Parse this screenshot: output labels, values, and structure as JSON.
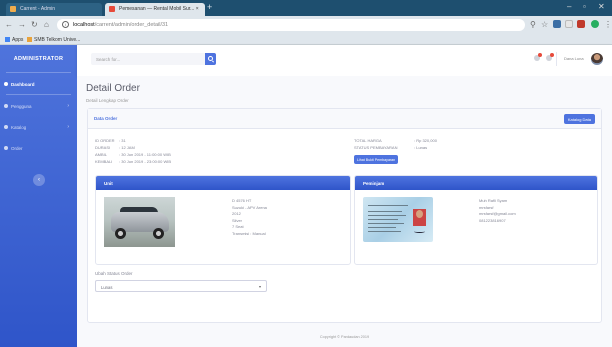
{
  "browser": {
    "tabs": [
      {
        "label": "Carrent - Admin"
      },
      {
        "label": "Pemesanan — Rental Mobil Sur... ×"
      }
    ],
    "url_host": "localhost",
    "url_path": "/carrent/admin/order_detail/31",
    "bookmarks": [
      {
        "label": "Apps"
      },
      {
        "label": "SMB Telkom Unive..."
      }
    ]
  },
  "sidebar": {
    "brand": "ADMINISTRATOR",
    "items": [
      {
        "label": "Dashboard",
        "active": true
      },
      {
        "label": "Pengguna",
        "chevron": "›"
      },
      {
        "label": "Katalog",
        "chevron": "›"
      },
      {
        "label": "Order"
      }
    ],
    "toggle": "‹"
  },
  "topbar": {
    "search_placeholder": "Search for...",
    "username": "Dana Luna"
  },
  "page": {
    "title": "Detail Order",
    "subtitle": "Detail Lengkap Order"
  },
  "card": {
    "title": "Data Order",
    "back_button": "Katalog Data"
  },
  "order": {
    "id_label": "ID ORDER",
    "id_value": "31",
    "durasi_label": "DURASI",
    "durasi_value": "12 JAM",
    "ambil_label": "AMBIL",
    "ambil_value": "30 Jun 2019 - 11:00:00 WIB",
    "kembali_label": "KEMBALI",
    "kembali_value": "30 Jun 2019 - 23:00:00 WIB",
    "total_label": "TOTAL HARGA",
    "total_value": "Rp 320,000",
    "status_label": "STATUS PEMBAYARAN",
    "status_value": "Lunas",
    "proof_button": "Lihat Bukti Pembayaran"
  },
  "unit": {
    "header": "Unit",
    "lines": [
      "D 4576 HT",
      "Suzuki - APV Arena",
      "2012",
      "Silver",
      "7 Seat",
      "Transmisi : Manual"
    ]
  },
  "peminjam": {
    "header": "Peminjam",
    "lines": [
      "Muh Rafli Syam",
      "mrsfarsf",
      "mrsfarsf@gmail.com",
      "081223816907"
    ]
  },
  "status_form": {
    "label": "Ubah Status Order",
    "selected": "Lunas"
  },
  "footer": "Copyright © Pardaudan 2019",
  "colors": {
    "primary": "#4e73df",
    "sidebar_bottom": "#2f55c9",
    "browser_chrome": "#1e4f6f"
  }
}
